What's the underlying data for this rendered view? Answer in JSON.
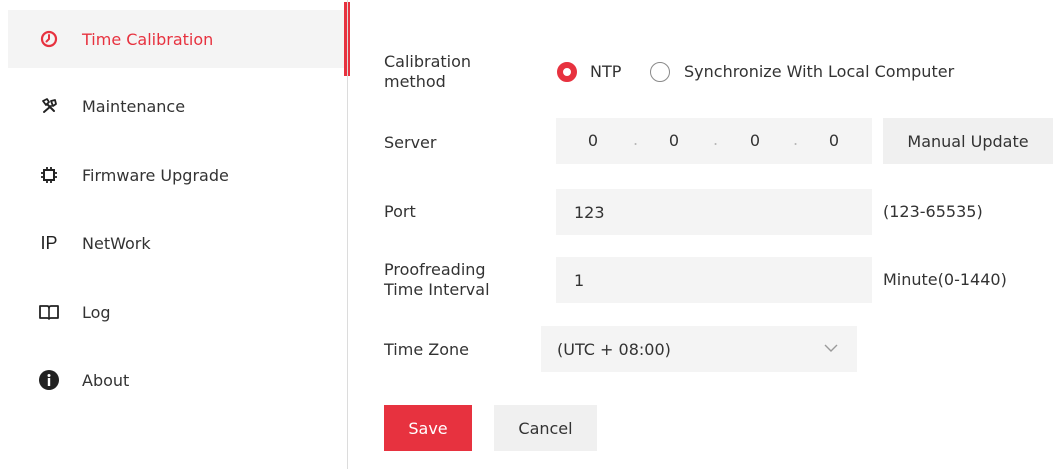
{
  "sidebar": {
    "items": [
      {
        "label": "Time Calibration",
        "icon": "clock-icon",
        "active": true
      },
      {
        "label": "Maintenance",
        "icon": "wrench-icon",
        "active": false
      },
      {
        "label": "Firmware Upgrade",
        "icon": "chip-icon",
        "active": false
      },
      {
        "label": "NetWork",
        "icon": "ip-icon",
        "active": false
      },
      {
        "label": "Log",
        "icon": "book-icon",
        "active": false
      },
      {
        "label": "About",
        "icon": "info-icon",
        "active": false
      }
    ],
    "ip_icon_text": "IP"
  },
  "form": {
    "calibration_method": {
      "label_line1": "Calibration",
      "label_line2": "method",
      "options": [
        {
          "label": "NTP",
          "checked": true
        },
        {
          "label": "Synchronize With Local Computer",
          "checked": false
        }
      ]
    },
    "server": {
      "label": "Server",
      "segments": [
        "0",
        "0",
        "0",
        "0"
      ],
      "dot": ".",
      "manual_update_label": "Manual Update"
    },
    "port": {
      "label": "Port",
      "value": "123",
      "hint": "(123-65535)"
    },
    "interval": {
      "label_line1": "Proofreading",
      "label_line2": "Time Interval",
      "value": "1",
      "hint": "Minute(0-1440)"
    },
    "time_zone": {
      "label": "Time Zone",
      "value": "(UTC + 08:00)"
    }
  },
  "actions": {
    "save_label": "Save",
    "cancel_label": "Cancel"
  },
  "colors": {
    "accent": "#e7323f",
    "field_bg": "#f4f4f4",
    "text": "#333333"
  }
}
